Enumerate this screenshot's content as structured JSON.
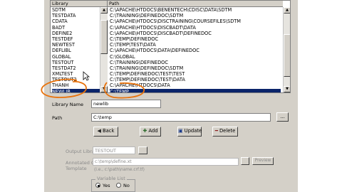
{
  "table": {
    "col_library": "Library",
    "col_path": "Path",
    "rows": [
      {
        "lib": "SDTM",
        "path": "C:\\APACHE\\HTDOCS\\BENENTECH\\CDISC\\DATA\\SDTM"
      },
      {
        "lib": "TESTDATA",
        "path": "C:\\TRAINING\\DEFINEDOC\\SDTM"
      },
      {
        "lib": "CDATA",
        "path": "C:\\APACHE\\HTDOCS\\DISCTRAINING\\COURSEFILES\\SDTM"
      },
      {
        "lib": "BADT",
        "path": "C:\\APACHE\\HTDOCS\\DISCBADT\\DATA"
      },
      {
        "lib": "DEFINE2",
        "path": "C:\\APACHE\\HTDOCS\\DISCBADT\\DEFINEDOC"
      },
      {
        "lib": "TESTDEF",
        "path": "C:\\TEMP\\DEFINEDOC"
      },
      {
        "lib": "NEWTEST",
        "path": "C:\\TEMP\\TEST\\DATA"
      },
      {
        "lib": "DEFLIBL",
        "path": "C:\\APACHE\\HTDOCS\\DATA\\DEFINEDOC"
      },
      {
        "lib": "GLOBAL",
        "path": "C:\\GLOBAL"
      },
      {
        "lib": "TESTOUT",
        "path": "C:\\TRAINING\\DEFINEDOC"
      },
      {
        "lib": "TESTDAT2",
        "path": "C:\\TRAINING\\DEFINEDOC\\SDTM"
      },
      {
        "lib": "XMLTEST",
        "path": "C:\\TEMP\\DEFINEDOC\\TEST\\TEST"
      },
      {
        "lib": "TESTOUT2",
        "path": "C:\\TEMP\\DEFINEDOC\\TEST\\DATA"
      },
      {
        "lib": "THANH",
        "path": "C:\\APACHE\\HTDOCS\\DATA"
      },
      {
        "lib": "NEWLIB",
        "path": "C:\\TEMP"
      }
    ],
    "selected_index": 14
  },
  "form": {
    "library_name_label": "Library Name",
    "library_name_value": "newlib",
    "path_label": "Path",
    "path_value": "C:\\temp",
    "browse_label": "..."
  },
  "buttons": {
    "back": "Back",
    "add": "Add",
    "update": "Update",
    "delete": "Delete"
  },
  "lower": {
    "output_library_label": "Output Library",
    "output_library_value": "TESTOUT",
    "annotated_crf_label_1": "Annotated CRF",
    "annotated_crf_label_2": "Template",
    "annotated_crf_value": "c:\\temp\\define.xt",
    "annotated_crf_hint": "(i.e., c:\\path\\name.crf.tf)",
    "preview_button": "Preview",
    "variable_list_label": "Variable List",
    "yes_label": "Yes",
    "no_label": "No"
  },
  "colors": {
    "panel": "#d4d0c8",
    "selection": "#0a246a",
    "annotation": "#e8720c"
  }
}
